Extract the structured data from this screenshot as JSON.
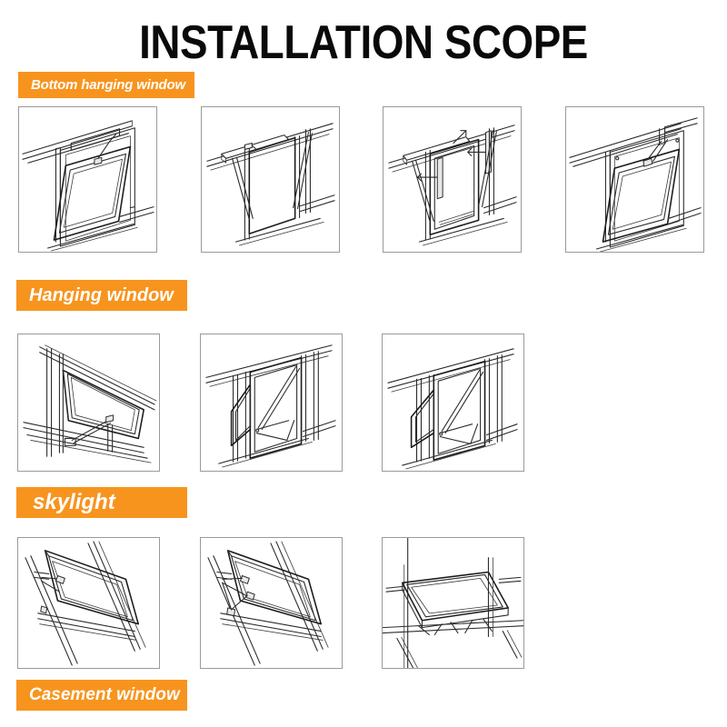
{
  "header": {
    "title": "INSTALLATION SCOPE"
  },
  "sections": [
    {
      "id": "bottom-hanging-window",
      "label": "Bottom hanging window",
      "panels": [
        {
          "id": "bottom-hanging-1",
          "caption": ""
        },
        {
          "id": "bottom-hanging-2",
          "caption": ""
        },
        {
          "id": "bottom-hanging-3",
          "caption": ""
        },
        {
          "id": "bottom-hanging-4",
          "caption": ""
        }
      ]
    },
    {
      "id": "hanging-window",
      "label": "Hanging window",
      "panels": [
        {
          "id": "hanging-1",
          "caption": ""
        },
        {
          "id": "hanging-2",
          "caption": ""
        },
        {
          "id": "hanging-3",
          "caption": ""
        }
      ]
    },
    {
      "id": "skylight",
      "label": "skylight",
      "panels": [
        {
          "id": "skylight-1",
          "caption": ""
        },
        {
          "id": "skylight-2",
          "caption": ""
        },
        {
          "id": "skylight-3",
          "caption": ""
        }
      ]
    },
    {
      "id": "casement-window",
      "label": "Casement window",
      "panels": []
    }
  ],
  "colors": {
    "accent": "#f7941e",
    "label_text": "#ffffff",
    "title_text": "#0a0a0a",
    "panel_border": "#9a9a9a",
    "drawing_line": "#2b2b2b",
    "background": "#ffffff"
  }
}
